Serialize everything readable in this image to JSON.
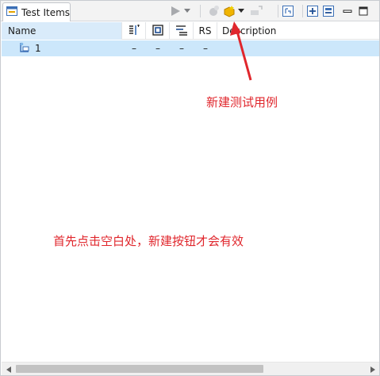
{
  "tab": {
    "title": "Test Items"
  },
  "toolbar": {
    "icons": [
      "run-icon",
      "run-dropdown-icon",
      "add-test-item-disabled-icon",
      "new-test-case-icon",
      "new-dropdown-icon",
      "import-icon",
      "link-icon",
      "expand-all-icon",
      "collapse-all-icon",
      "minimize-icon",
      "maximize-icon"
    ]
  },
  "columns": {
    "name": "Name",
    "rs": "RS",
    "description": "Description"
  },
  "rows": [
    {
      "name": "1",
      "values": [
        "–",
        "–",
        "–",
        "–"
      ]
    }
  ],
  "annotations": {
    "new_test_case": "新建测试用例",
    "hint": "首先点击空白处，新建按钮才会有效"
  },
  "colors": {
    "accent": "#e0262c",
    "selection": "#cce7fb",
    "header_sorted": "#d9ebfa"
  }
}
